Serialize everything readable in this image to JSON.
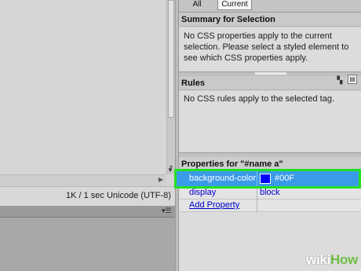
{
  "status_bar": {
    "text": "1K / 1 sec  Unicode (UTF-8)"
  },
  "css_panel": {
    "tabs": [
      {
        "label": "All",
        "selected": false
      },
      {
        "label": "Current",
        "selected": true
      }
    ],
    "summary": {
      "title": "Summary for Selection",
      "message": "No CSS properties apply to the current selection.  Please select a styled element to see which CSS properties apply."
    },
    "rules": {
      "title": "Rules",
      "message": "No CSS rules apply to the selected tag."
    },
    "properties": {
      "title": "Properties for \"#name a\"",
      "rows": [
        {
          "name": "background-color",
          "value": "#00F",
          "swatch_color": "#0000ff",
          "highlighted": true
        },
        {
          "name": "display",
          "value": "block",
          "highlighted": false
        }
      ],
      "add_property_label": "Add Property"
    }
  },
  "colors": {
    "highlight_row": "#3a9be8",
    "highlight_outline": "#22e022",
    "property_text": "#0000cc"
  },
  "watermark": {
    "wiki": "wiki",
    "how": "How"
  }
}
